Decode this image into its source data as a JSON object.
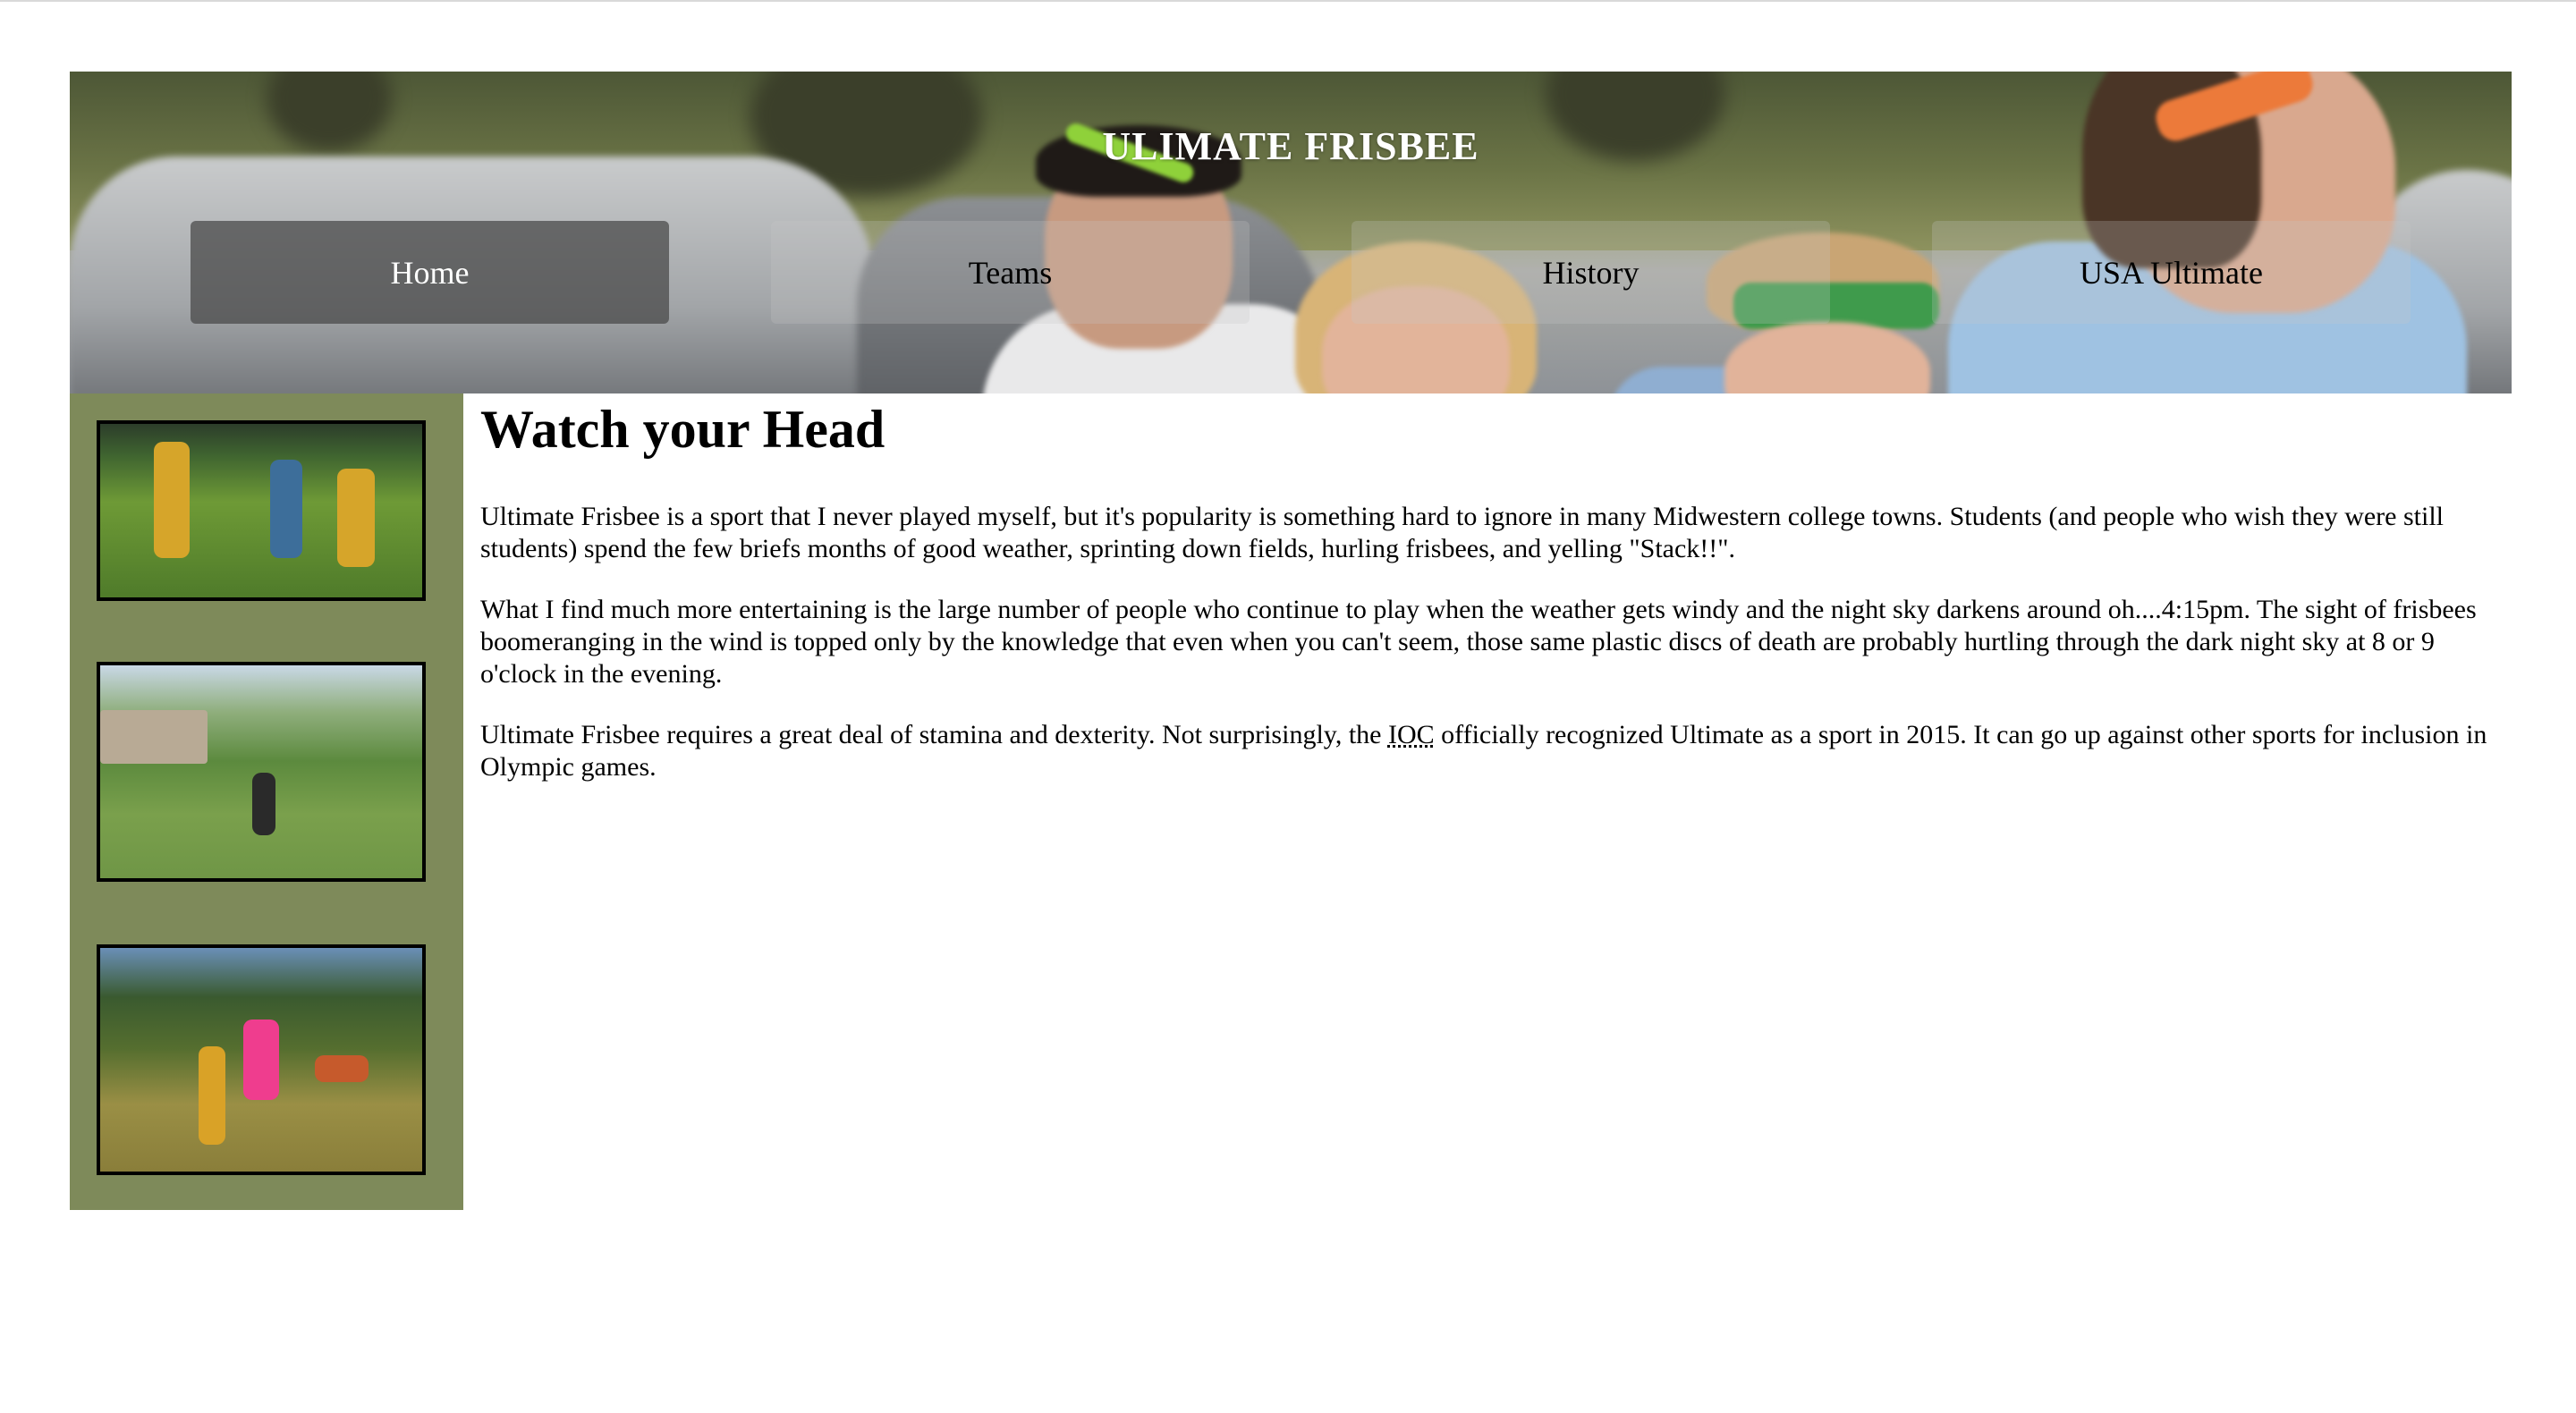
{
  "header": {
    "title": "ULIMATE FRISBEE",
    "nav": [
      {
        "label": "Home",
        "active": true
      },
      {
        "label": "Teams",
        "active": false
      },
      {
        "label": "History",
        "active": false
      },
      {
        "label": "USA Ultimate",
        "active": false
      }
    ]
  },
  "sidebar": {
    "images": [
      {
        "alt": "players-throwing-frisbee"
      },
      {
        "alt": "player-leaping-in-park"
      },
      {
        "alt": "players-catching-frisbee"
      }
    ]
  },
  "article": {
    "heading": "Watch your Head",
    "p1": "Ultimate Frisbee is a sport that I never played myself, but it's popularity is something hard to ignore in many Midwestern college towns. Students (and people who wish they were still students) spend the few briefs months of good weather, sprinting down fields, hurling frisbees, and yelling \"Stack!!\".",
    "p2": "What I find much more entertaining is the large number of people who continue to play when the weather gets windy and the night sky darkens around oh....4:15pm. The sight of frisbees boomeranging in the wind is topped only by the knowledge that even when you can't seem, those same plastic discs of death are probably hurtling through the dark night sky at 8 or 9 o'clock in the evening.",
    "p3_before": "Ultimate Frisbee requires a great deal of stamina and dexterity. Not surprisingly, the ",
    "p3_abbr": "IOC",
    "p3_after": " officially recognized Ultimate as a sport in 2015. It can go up against other sports for inclusion in Olympic games."
  },
  "colors": {
    "sidebar_bg": "#7e8a5a",
    "nav_active_bg": "#464646",
    "title_color": "#ffffff"
  }
}
